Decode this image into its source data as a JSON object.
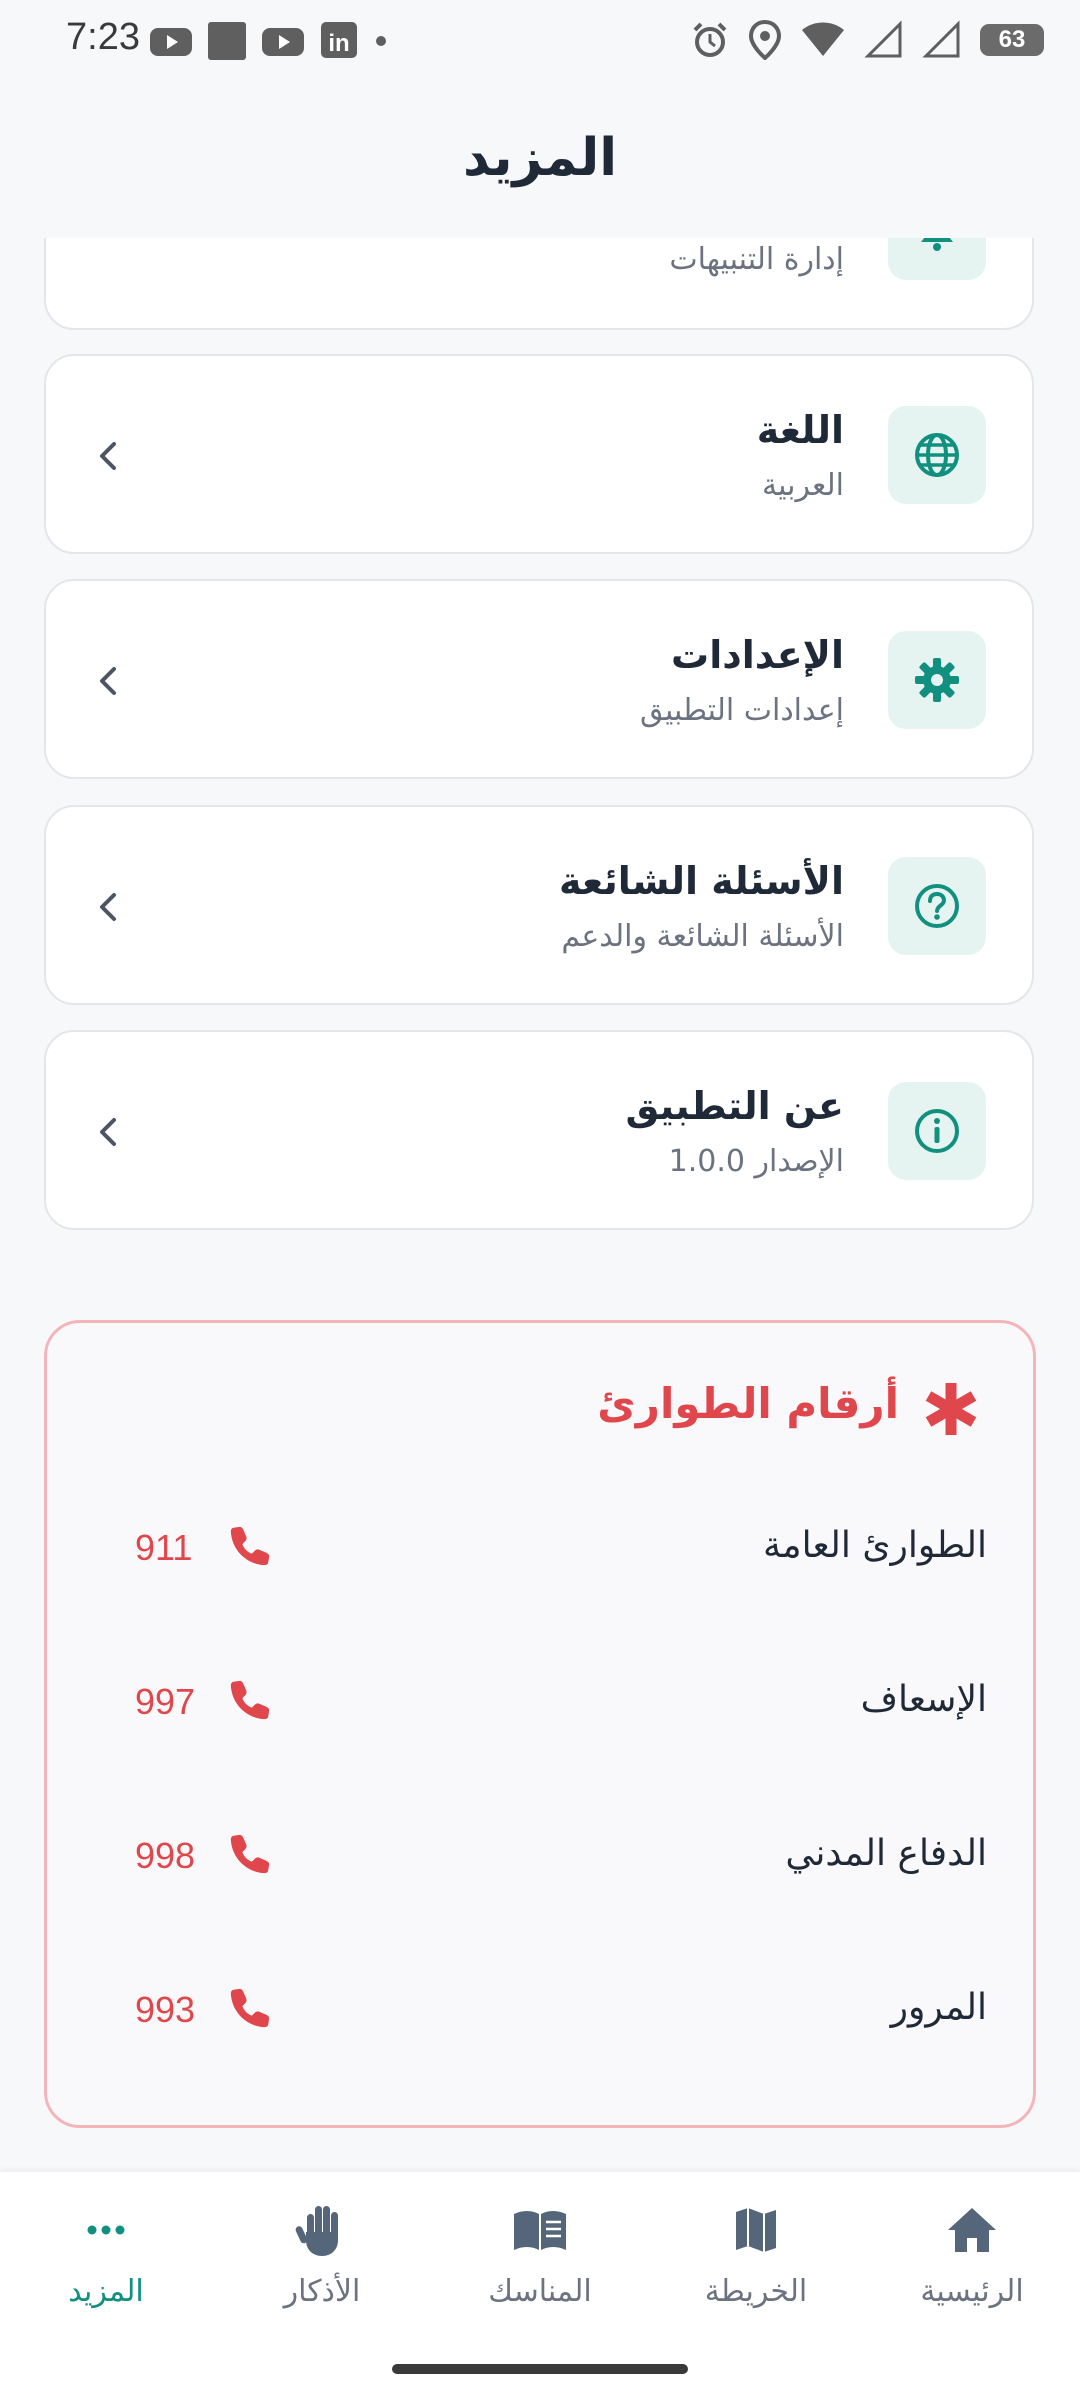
{
  "status_bar": {
    "time": "7:23",
    "battery": "63"
  },
  "header": {
    "title": "المزيد"
  },
  "menu": [
    {
      "title": "",
      "subtitle": "إدارة التنبيهات",
      "icon": "bell-icon"
    },
    {
      "title": "اللغة",
      "subtitle": "العربية",
      "icon": "globe-icon"
    },
    {
      "title": "الإعدادات",
      "subtitle": "إعدادات التطبيق",
      "icon": "gear-icon"
    },
    {
      "title": "الأسئلة الشائعة",
      "subtitle": "الأسئلة الشائعة والدعم",
      "icon": "help-circle-icon"
    },
    {
      "title": "عن التطبيق",
      "subtitle": "الإصدار 1.0.0",
      "icon": "info-icon"
    }
  ],
  "emergency": {
    "title": "أرقام الطوارئ",
    "contacts": [
      {
        "name": "الطوارئ العامة",
        "number": "911"
      },
      {
        "name": "الإسعاف",
        "number": "997"
      },
      {
        "name": "الدفاع المدني",
        "number": "998"
      },
      {
        "name": "المرور",
        "number": "993"
      }
    ]
  },
  "bottom_nav": {
    "items": [
      {
        "label": "الرئيسية",
        "icon": "home-icon"
      },
      {
        "label": "الخريطة",
        "icon": "map-icon"
      },
      {
        "label": "المناسك",
        "icon": "book-icon"
      },
      {
        "label": "الأذكار",
        "icon": "hand-icon"
      },
      {
        "label": "المزيد",
        "icon": "more-icon",
        "active": true
      }
    ]
  },
  "colors": {
    "accent": "#11907F",
    "emergency": "#E0474C",
    "icon_bg": "#E6F4F1"
  }
}
